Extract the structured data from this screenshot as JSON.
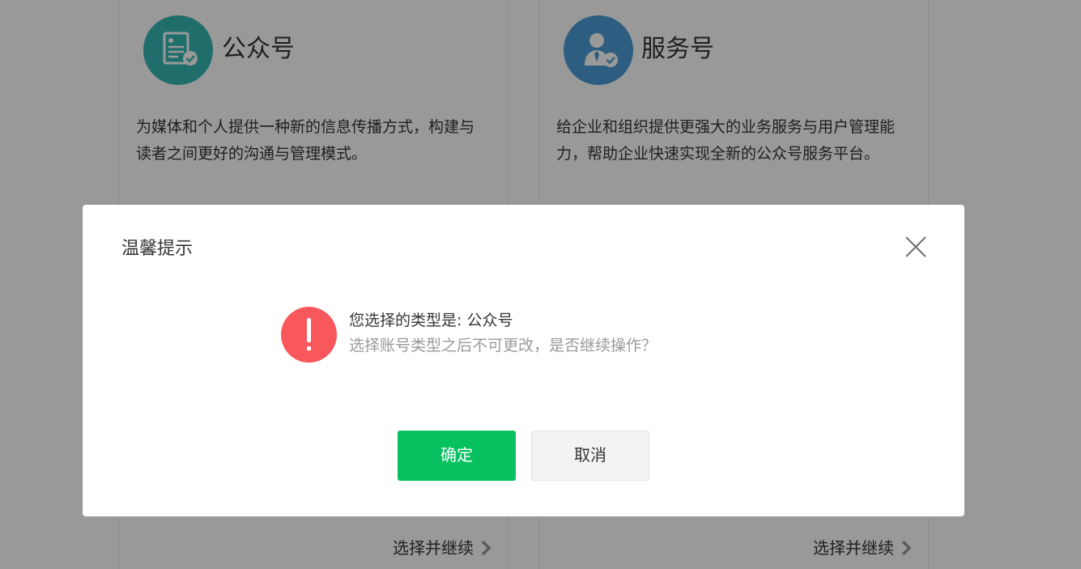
{
  "cards": [
    {
      "icon": "document-check-icon",
      "title": "公众号",
      "description": "为媒体和个人提供一种新的信息传播方式，构建与读者之间更好的沟通与管理模式。",
      "action_label": "选择并继续",
      "accent": "#34b7b3"
    },
    {
      "icon": "person-check-icon",
      "title": "服务号",
      "description": "给企业和组织提供更强大的业务服务与用户管理能力，帮助企业快速实现全新的公众号服务平台。",
      "action_label": "选择并继续",
      "accent": "#4b9bd6"
    }
  ],
  "dialog": {
    "title": "温馨提示",
    "icon": "warning-icon",
    "message": "您选择的类型是: 公众号",
    "sub_message": "选择账号类型之后不可更改，是否继续操作？",
    "confirm_label": "确定",
    "cancel_label": "取消",
    "confirm_color": "#07c160",
    "warning_color": "#f8575c"
  }
}
